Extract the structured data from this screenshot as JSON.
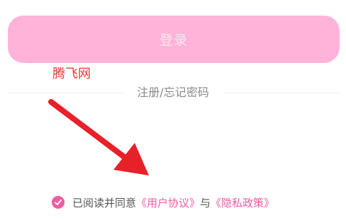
{
  "login": {
    "button_label": "登录"
  },
  "watermark": {
    "text": "腾飞网"
  },
  "auth": {
    "register_forgot_label": "注册/忘记密码"
  },
  "agreement": {
    "checked": true,
    "prefix": "已阅读并同意",
    "user_agreement": "《用户协议》",
    "conjunction": "与",
    "privacy_policy": "《隐私政策》"
  },
  "colors": {
    "login_button_bg": "#ffb3d9",
    "accent": "#f05ba2",
    "arrow": "#e8202a"
  },
  "icons": {
    "checkbox": "check-icon",
    "annotation": "arrow-icon"
  }
}
